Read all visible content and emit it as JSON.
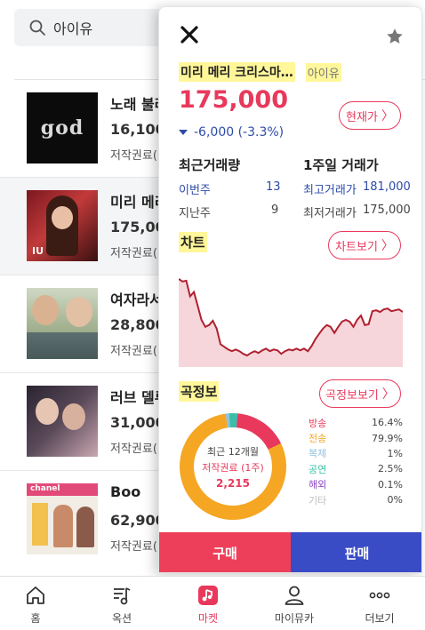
{
  "search": {
    "query": "아이유"
  },
  "list": [
    {
      "title": "노래 불러",
      "price": "16,100",
      "sub": "저작권료("
    },
    {
      "title": "미리 메리",
      "price": "175,000",
      "sub": "저작권료("
    },
    {
      "title": "여자라서",
      "price": "28,800",
      "sub": "저작권료("
    },
    {
      "title": "러브 델루",
      "price": "31,000",
      "sub": "저작권료("
    },
    {
      "title": "Boo",
      "price": "62,900",
      "sub": "저작권료("
    }
  ],
  "thumbs": {
    "god": "god",
    "iu": "IU",
    "chanel": "chanel"
  },
  "panel": {
    "song": "미리 메리 크리스마…",
    "artist": "아이유",
    "price": "175,000",
    "change": "-6,000 (-3.3%)",
    "now_button": "현재가",
    "volume_title": "최근거래량",
    "this_week_label": "이번주",
    "this_week_value": "13",
    "last_week_label": "지난주",
    "last_week_value": "9",
    "week_title": "1주일 거래가",
    "high_label": "최고거래가",
    "high_value": "181,000",
    "low_label": "최저거래가",
    "low_value": "175,000",
    "chart_title": "차트",
    "chart_button": "차트보기",
    "info_title": "곡정보",
    "info_button": "곡정보보기",
    "pie_line1": "최근 12개월",
    "pie_line2": "저작권료 (1주)",
    "pie_line3": "2,215",
    "buy": "구매",
    "sell": "판매"
  },
  "chart_data": [
    {
      "type": "area",
      "x": [
        0,
        1,
        2,
        3,
        4,
        5,
        6,
        7,
        8,
        9,
        10,
        11,
        12,
        13,
        14,
        15,
        16,
        17,
        18,
        19,
        20,
        21,
        22,
        23,
        24,
        25,
        26,
        27,
        28,
        29,
        30,
        31,
        32,
        33,
        34,
        35,
        36,
        37,
        38,
        39,
        40,
        41,
        42,
        43,
        44,
        45,
        46,
        47,
        48,
        49,
        50,
        51,
        52,
        53,
        54,
        55,
        56,
        57,
        58,
        59
      ],
      "values": [
        95,
        92,
        93,
        75,
        80,
        64,
        48,
        40,
        42,
        47,
        38,
        20,
        17,
        14,
        12,
        14,
        12,
        9,
        7,
        10,
        12,
        10,
        13,
        15,
        12,
        14,
        13,
        9,
        12,
        14,
        13,
        15,
        13,
        15,
        12,
        18,
        26,
        32,
        38,
        42,
        40,
        33,
        40,
        46,
        48,
        46,
        40,
        48,
        53,
        42,
        43,
        58,
        59,
        57,
        60,
        61,
        58,
        59,
        60,
        57
      ],
      "color": "#b02030",
      "fill": "#f6d6da"
    },
    {
      "type": "pie",
      "categories": [
        "방송",
        "전송",
        "복제",
        "공연",
        "해외",
        "기타"
      ],
      "values": [
        16.4,
        79.9,
        1,
        2.5,
        0.1,
        0
      ],
      "labels": [
        "16.4%",
        "79.9%",
        "1%",
        "2.5%",
        "0.1%",
        "0%"
      ],
      "colors": [
        "#e8395c",
        "#f5a623",
        "#8fc1e3",
        "#37c0a6",
        "#8a44c7",
        "#bdbdbd"
      ]
    }
  ],
  "nav": [
    {
      "label": "홈",
      "icon": "home-icon"
    },
    {
      "label": "옥션",
      "icon": "auction-icon"
    },
    {
      "label": "마켓",
      "icon": "market-icon"
    },
    {
      "label": "마이뮤카",
      "icon": "profile-icon"
    },
    {
      "label": "더보기",
      "icon": "more-icon"
    }
  ]
}
